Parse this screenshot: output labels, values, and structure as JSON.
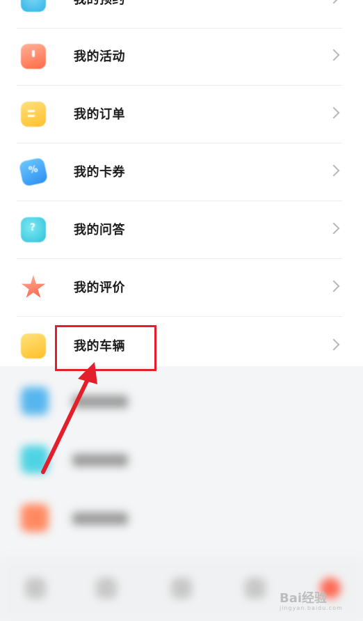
{
  "menu": {
    "items": [
      {
        "label": "我的预约",
        "icon": "calendar-icon"
      },
      {
        "label": "我的活动",
        "icon": "activity-bag-icon"
      },
      {
        "label": "我的订单",
        "icon": "order-list-icon"
      },
      {
        "label": "我的卡券",
        "icon": "coupon-icon"
      },
      {
        "label": "我的问答",
        "icon": "qa-bubble-icon"
      },
      {
        "label": "我的评价",
        "icon": "star-review-icon"
      },
      {
        "label": "我的车辆",
        "icon": "car-icon"
      }
    ]
  },
  "annotation": {
    "highlight_color": "#e21f2b",
    "highlighted_item": "我的车辆"
  },
  "watermark": {
    "text": "Bai经验",
    "sub": "jingyan.baidu.com"
  }
}
